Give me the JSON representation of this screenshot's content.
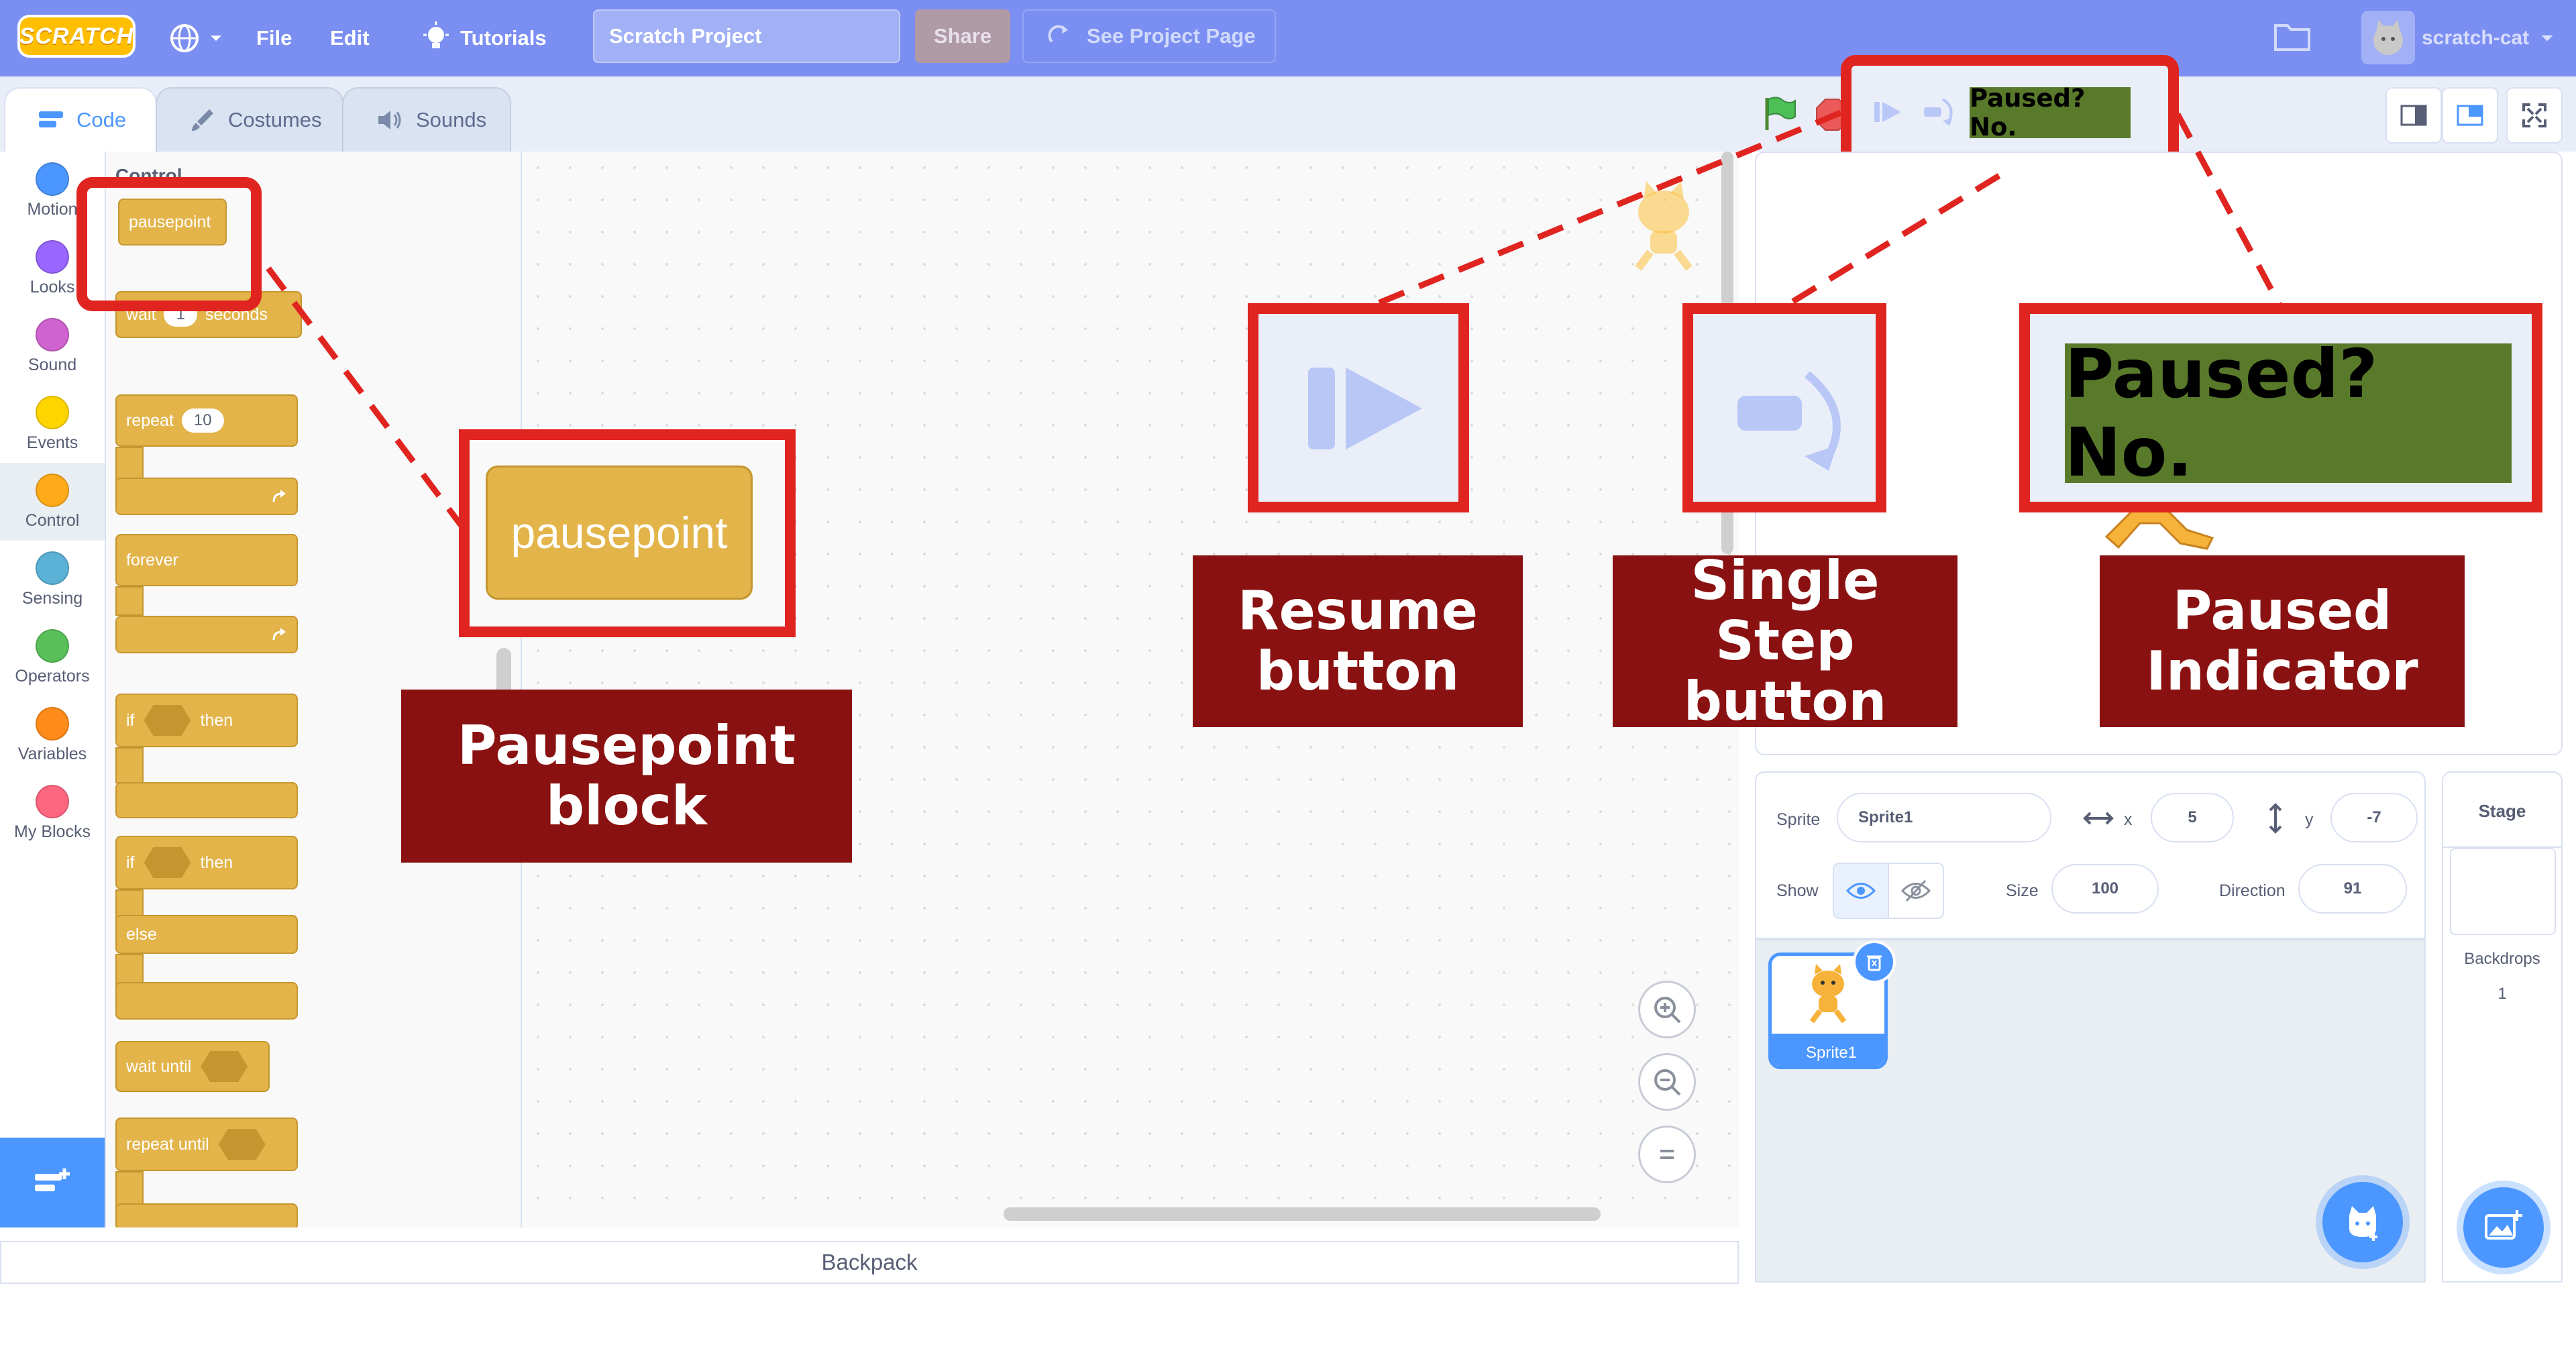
{
  "menubar": {
    "logo": "SCRATCH",
    "file": "File",
    "edit": "Edit",
    "tutorials": "Tutorials",
    "project_title": "Scratch Project",
    "share": "Share",
    "see_project_page": "See Project Page",
    "username": "scratch-cat"
  },
  "tabs": [
    {
      "label": "Code",
      "active": true
    },
    {
      "label": "Costumes",
      "active": false
    },
    {
      "label": "Sounds",
      "active": false
    }
  ],
  "categories": [
    {
      "label": "Motion",
      "color": "#4c97ff"
    },
    {
      "label": "Looks",
      "color": "#9966ff"
    },
    {
      "label": "Sound",
      "color": "#cf63cf"
    },
    {
      "label": "Events",
      "color": "#ffd500"
    },
    {
      "label": "Control",
      "color": "#ffab19"
    },
    {
      "label": "Sensing",
      "color": "#5cb1d6"
    },
    {
      "label": "Operators",
      "color": "#59c059"
    },
    {
      "label": "Variables",
      "color": "#ff8c1a"
    },
    {
      "label": "My Blocks",
      "color": "#ff6680"
    }
  ],
  "palette": {
    "heading": "Control",
    "pausepoint": "pausepoint",
    "wait": "wait",
    "wait_value": "1",
    "seconds": "seconds",
    "repeat": "repeat",
    "repeat_value": "10",
    "forever": "forever",
    "if": "if",
    "then": "then",
    "else": "else",
    "wait_until": "wait until",
    "repeat_until": "repeat until"
  },
  "backpack": "Backpack",
  "sprite_info": {
    "sprite_label": "Sprite",
    "sprite_name": "Sprite1",
    "x_label": "x",
    "x_value": "5",
    "y_label": "y",
    "y_value": "-7",
    "show_label": "Show",
    "size_label": "Size",
    "size_value": "100",
    "direction_label": "Direction",
    "direction_value": "91"
  },
  "sprite_list": [
    {
      "name": "Sprite1"
    }
  ],
  "stage_panel": {
    "title": "Stage",
    "backdrops_label": "Backdrops",
    "backdrops_count": "1"
  },
  "stage_controls": {
    "paused_indicator": "Paused? No."
  },
  "annotations": {
    "pausepoint_block": "pausepoint",
    "pausepoint_label": "Pausepoint block",
    "resume_label": "Resume button",
    "single_step_label": "Single Step button",
    "paused_indicator_text": "Paused? No.",
    "paused_indicator_label": "Paused Indicator"
  },
  "colors": {
    "menubar": "#7b8ff2",
    "annotation_red": "#e02520",
    "label_bg": "#8a1111",
    "paused_green": "#5a7a2b",
    "control_block": "#e3b44a"
  }
}
